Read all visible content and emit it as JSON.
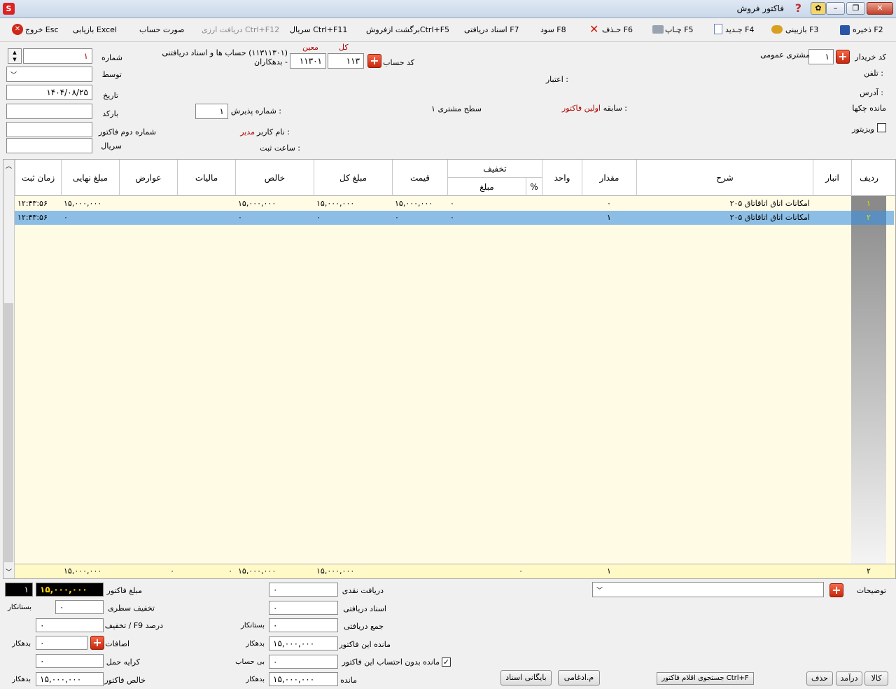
{
  "window": {
    "title": "فاکتور فروش",
    "app_logo": "S"
  },
  "toolbar": {
    "save": "ذخیره F2",
    "search": "بازبینی F3",
    "new": "جـدید F4",
    "print": "چـاپ F5",
    "delete": "حـذف F6",
    "profit": "سود F8",
    "received_docs": "اسناد دریافتی F7",
    "return_sale": "برگشت ازفروشCtrl+F5",
    "serial": "سریال  Ctrl+F11",
    "currency": "دریافت ارزی Ctrl+F12",
    "statement": "صورت حساب",
    "excel": "بازیابی Excel",
    "exit": "خروج Esc"
  },
  "header": {
    "buyer_code_label": "کد خریدار",
    "buyer_code": "۱",
    "buyer_name": "مشتری عمومی",
    "phone_label": "تلفن :",
    "address_label": "آدرس :",
    "cheques_label": "مانده چکها",
    "visitor_label": "ویزیتور",
    "credit_label": "اعتبار :",
    "history_label": "سابقه :",
    "history_value": "اولین فاکتور",
    "level_label": "سطح مشتری ۱",
    "account_code_label": "کد حساب",
    "kol_label": "کل",
    "moin_label": "معین",
    "kol_value": "۱۱۳",
    "moin_value": "۱۱۳۰۱",
    "account_desc": "(۱۱۳۱۱۳۰۱) حساب ها و اسناد دریافتنی - بدهکاران",
    "reception_label": "شماره پذیرش :",
    "reception_value": "۱",
    "username_label": "نام کاربر :",
    "username_value": "مدیر",
    "reg_time_label": "ساعت ثبت :",
    "number_label": "شماره",
    "number_value": "۱",
    "by_label": "توسط",
    "date_label": "تاریخ",
    "date_value": "۱۴۰۴/۰۸/۲۵",
    "barcode_label": "بارکد",
    "second_no_label": "شماره دوم فاکتور",
    "serial_label": "سریال"
  },
  "grid": {
    "columns": {
      "row": "ردیف",
      "store": "انبار",
      "desc": "شرح",
      "qty": "مقدار",
      "unit": "واحد",
      "discount": "تخفیف",
      "pct": "%",
      "amount": "مبلغ",
      "price": "قیمت",
      "total": "مبلغ کل",
      "net": "خالص",
      "tax": "مالیات",
      "duties": "عوارض",
      "final": "مبلغ نهایی",
      "time": "زمان ثبت"
    },
    "rows": [
      {
        "row": "۱",
        "desc": "امکانات اتاق اتاقاتاق ۲۰۵",
        "qty": "۰",
        "amount": "۰",
        "price": "۱۵,۰۰۰,۰۰۰",
        "total": "۱۵,۰۰۰,۰۰۰",
        "net": "۱۵,۰۰۰,۰۰۰",
        "final": "۱۵,۰۰۰,۰۰۰",
        "time": "۱۲:۴۳:۵۶"
      },
      {
        "row": "۲",
        "desc": "امکانات اتاق اتاقاتاق ۲۰۵",
        "qty": "۱",
        "amount": "۰",
        "price": "۰",
        "total": "۰",
        "net": "۰",
        "final": "۰",
        "time": "۱۲:۴۳:۵۶"
      }
    ],
    "footer": {
      "row": "۲",
      "qty": "۱",
      "amount": "۰",
      "total": "۱۵,۰۰۰,۰۰۰",
      "net": "۱۵,۰۰۰,۰۰۰",
      "tax": "۰",
      "duties": "۰",
      "final": "۱۵,۰۰۰,۰۰۰"
    }
  },
  "summary": {
    "notes_label": "توضیحات",
    "cash_label": "دریافت نقدی",
    "cash_value": "۰",
    "docs_label": "اسناد دریافتی",
    "docs_value": "۰",
    "sum_label": "جمع دریافتی",
    "sum_value": "۰",
    "sum_side": "بستانکار",
    "remain_inv_label": "مانده این فاکتور",
    "remain_inv_value": "۱۵,۰۰۰,۰۰۰",
    "remain_inv_side": "بدهکار",
    "remain_noinv_label": "مانده بدون احتساب این فاکتور",
    "remain_noinv_value": "۰",
    "remain_noinv_side": "بی حساب",
    "remain_label": "مانده",
    "remain_value": "۱۵,۰۰۰,۰۰۰",
    "remain_side": "بدهکار",
    "invoice_amount_label": "مبلغ فاکتور",
    "invoice_amount_value": "۱۵,۰۰۰,۰۰۰",
    "invoice_count": "۱",
    "row_discount_label": "تخفیف سطری",
    "row_discount_value": "۰",
    "row_discount_side": "بستانکار",
    "pct_discount_label": "تخفیف / F9 درصد",
    "pct_discount_value": "۰",
    "additions_label": "اضافات",
    "additions_value": "۰",
    "additions_side": "بدهکار",
    "freight_label": "کرایه حمل",
    "freight_value": "۰",
    "net_invoice_label": "خالص فاکتور",
    "net_invoice_value": "۱۵,۰۰۰,۰۰۰",
    "net_invoice_side": "بدهکار"
  },
  "buttons": {
    "archive": "بایگانی اسناد",
    "merge": "م.ادغامی",
    "search_items": "جستجوی اقلام فاکتور Ctrl+F",
    "goods": "کالا",
    "income": "درآمد",
    "del": "حذف"
  },
  "icons": {
    "save": "floppy-icon",
    "print": "printer-icon",
    "delete": "red-x-icon",
    "new": "document-icon",
    "exit": "red-circle-x-icon",
    "help": "help-icon"
  }
}
